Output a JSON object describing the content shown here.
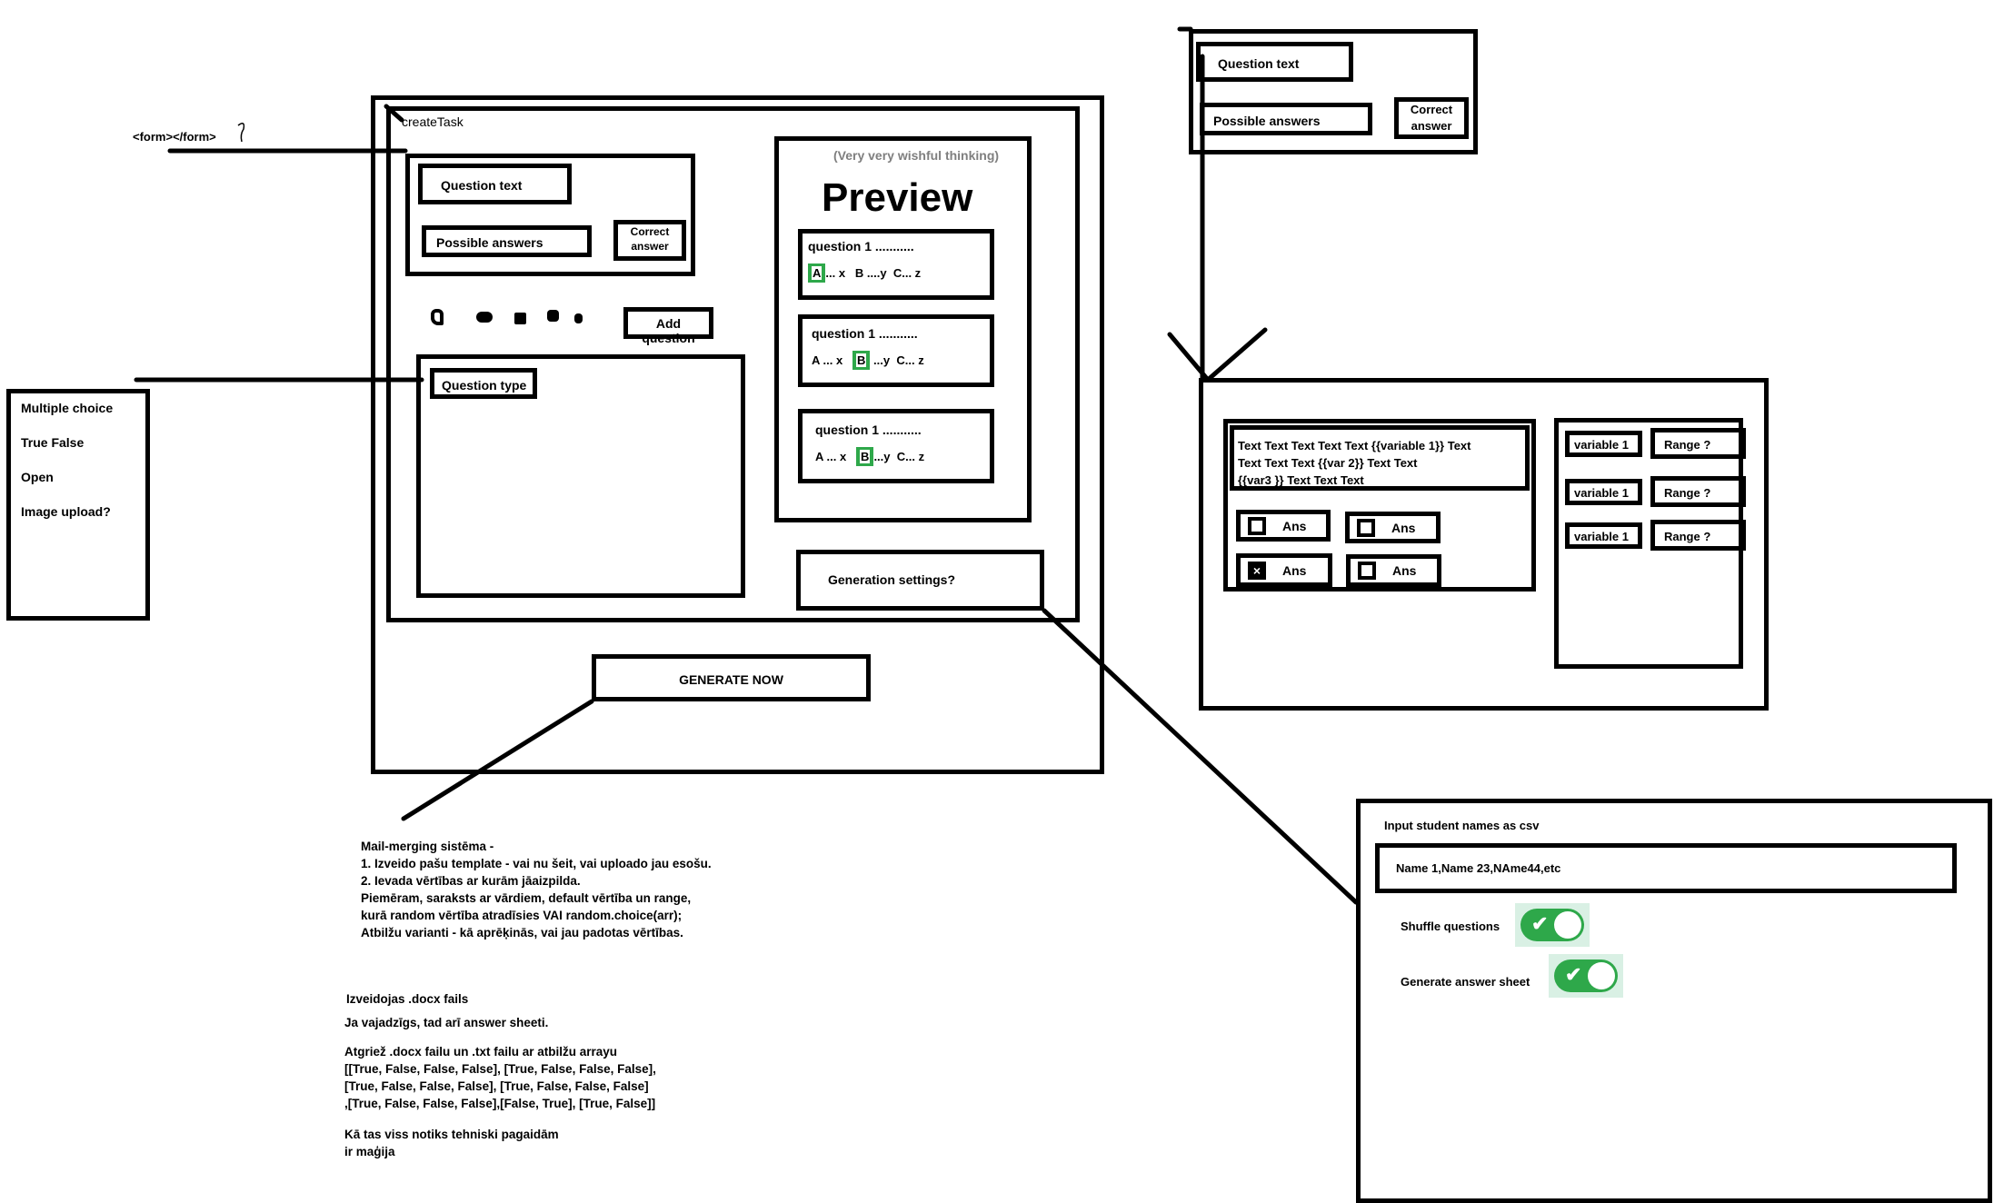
{
  "form_note": {
    "label": "<form></form>",
    "mark": "?"
  },
  "question_types": [
    "Multiple choice",
    "True False",
    "Open",
    "Image upload?"
  ],
  "create_task": {
    "title": "createTask",
    "question_text": "Question text",
    "possible_answers": "Possible answers",
    "correct_answer_1": "Correct",
    "correct_answer_2": "answer",
    "add_question": "Add question",
    "question_type": "Question type",
    "generate_now": "GENERATE NOW",
    "generation_settings": "Generation settings?"
  },
  "preview": {
    "note": "(Very very wishful thinking)",
    "title": "Preview",
    "cards": [
      {
        "question": "question 1 ...........",
        "a": "A",
        "a_rest": "... x",
        "b": "B",
        "b_rest": " ....y",
        "c": "C... z",
        "correct": "A"
      },
      {
        "question": "question 1 ...........",
        "a": "A",
        "a_rest": " ... x",
        "b": "B",
        "b_rest": " ...y",
        "c": "C... z",
        "correct": "B"
      },
      {
        "question": "question 1 ...........",
        "a": "A",
        "a_rest": " ... x",
        "b": "B",
        "b_rest": "...y",
        "c": "C... z",
        "correct": "B"
      }
    ]
  },
  "top_card": {
    "question_text": "Question text",
    "possible_answers": "Possible answers",
    "correct_1": "Correct",
    "correct_2": "answer"
  },
  "template": {
    "lines": [
      "Text  Text  Text  Text  Text  {{variable 1}} Text",
      "Text  Text  Text   {{var 2}} Text  Text",
      "{{var3 }} Text  Text  Text"
    ],
    "answers": [
      {
        "label": "Ans",
        "checked": false
      },
      {
        "label": "Ans",
        "checked": false
      },
      {
        "label": "Ans",
        "checked": true
      },
      {
        "label": "Ans",
        "checked": false
      }
    ],
    "variables": [
      {
        "name": "variable 1",
        "range": "Range ?"
      },
      {
        "name": "variable 1",
        "range": "Range ?"
      },
      {
        "name": "variable 1",
        "range": "Range ?"
      }
    ]
  },
  "settings": {
    "csv_label": "Input student names as csv",
    "csv_value": "Name 1,Name 23,NAme44,etc",
    "shuffle_label": "Shuffle questions",
    "shuffle_on": true,
    "answer_sheet_label": "Generate answer sheet",
    "answer_sheet_on": true
  },
  "notes": {
    "mail_merge": [
      "Mail-merging sistēma -",
      "1. Izveido pašu template - vai nu šeit, vai uploado jau esošu.",
      "2. Ievada vērtības ar kurām jāaizpilda.",
      "Piemēram, saraksts ar vārdiem, default vērtība un range,",
      "kurā random vērtība atradīsies VAI random.choice(arr);",
      "Atbilžu varianti - kā aprēķinās, vai jau padotas vērtības."
    ],
    "docx": "Izveidojas .docx fails",
    "answer_sheet": "Ja vajadzīgs, tad arī answer sheeti.",
    "returns": [
      "Atgriež .docx failu un .txt failu ar atbilžu arrayu",
      "[[True, False, False, False], [True, False, False, False],",
      "[True, False, False, False], [True, False, False, False]",
      ",[True, False, False, False],[False, True], [True, False]]"
    ],
    "magic": [
      "Kā tas viss notiks tehniski pagaidām",
      "ir maģija"
    ]
  },
  "colors": {
    "accent": "#2ea84a",
    "toggle_bg": "#d9f0e4"
  }
}
